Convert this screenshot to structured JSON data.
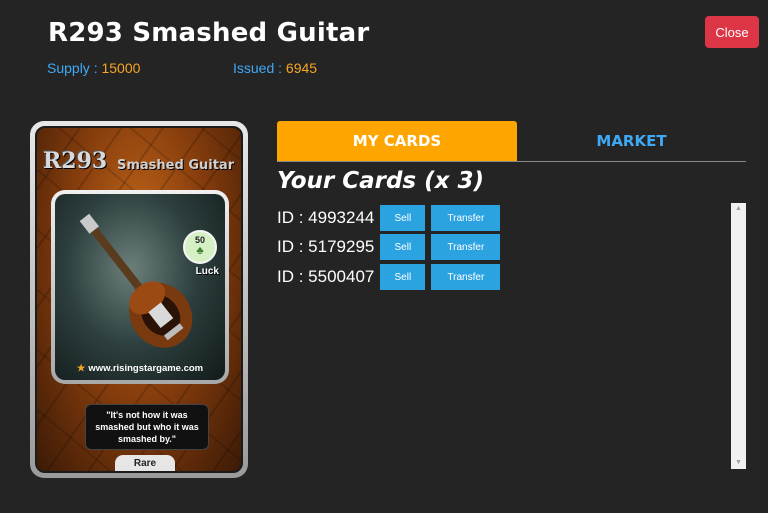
{
  "header": {
    "title": "R293 Smashed Guitar",
    "supply_label": "Supply : ",
    "supply_value": "15000",
    "issued_label": "Issued : ",
    "issued_value": "6945",
    "close_label": "Close"
  },
  "card": {
    "code": "R293",
    "name": "Smashed Guitar",
    "stat_value": "50",
    "stat_label": "Luck",
    "website": "www.risingstargame.com",
    "quote": "\"It's not how it was smashed but who it was smashed by.\"",
    "rarity": "Rare",
    "icons": [
      "clover-icon",
      "star-icon",
      "guitar-icon"
    ]
  },
  "tabs": [
    {
      "label": "MY CARDS",
      "active": true
    },
    {
      "label": "MARKET",
      "active": false
    }
  ],
  "cards_heading": "Your Cards (x 3)",
  "owned_cards": [
    {
      "id_text": "ID : 4993244",
      "sell_label": "Sell",
      "transfer_label": "Transfer"
    },
    {
      "id_text": "ID : 5179295",
      "sell_label": "Sell",
      "transfer_label": "Transfer"
    },
    {
      "id_text": "ID : 5500407",
      "sell_label": "Sell",
      "transfer_label": "Transfer"
    }
  ],
  "colors": {
    "accent_orange": "#ffa500",
    "accent_blue": "#3fa9f5",
    "button_blue": "#2ba3e0",
    "close_red": "#dc3545",
    "background": "#242424"
  }
}
